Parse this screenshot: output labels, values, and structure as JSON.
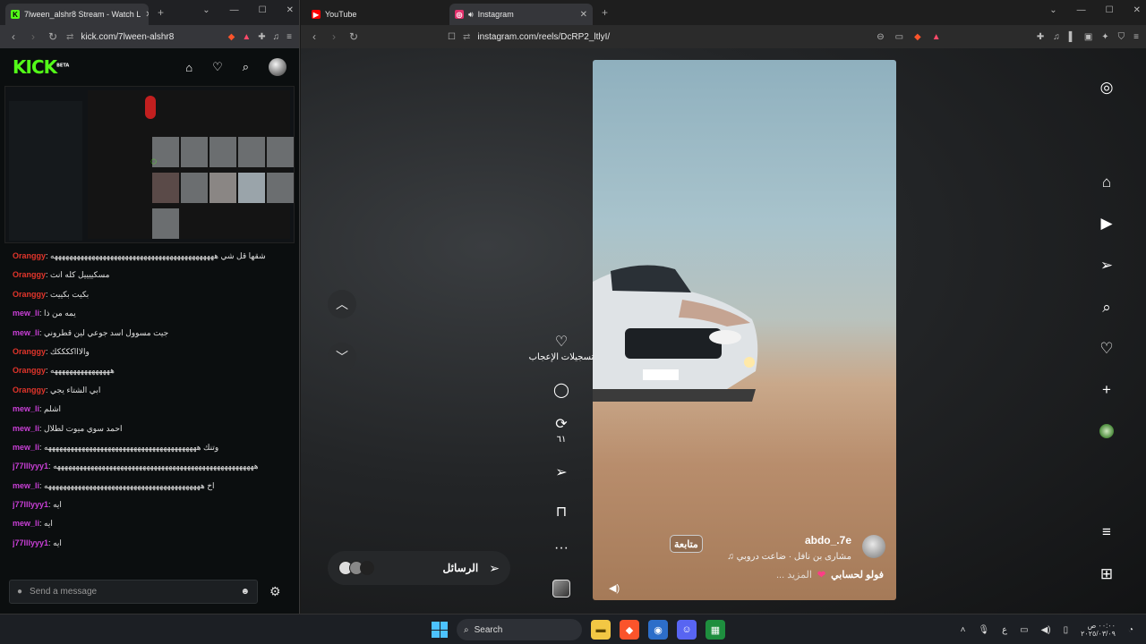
{
  "left_browser": {
    "tabs": [
      {
        "title": "7lween_alshr8 Stream - Watch L",
        "favicon": "kick-icon",
        "color": "#53fc18"
      }
    ],
    "url": "kick.com/7lween-alshr8",
    "kick": {
      "logo": "KICK",
      "beta": "BETA",
      "accent": "#53fc18"
    },
    "chat": {
      "messages": [
        {
          "user": "Oranggy",
          "color": "#e0352b",
          "text": "شقها قل شي ههههههههههههههههههههههههههههههههههههههههههههه"
        },
        {
          "user": "Oranggy",
          "color": "#e0352b",
          "text": "مسكييييل كله انت"
        },
        {
          "user": "Oranggy",
          "color": "#e0352b",
          "text": "بكيت بكييت"
        },
        {
          "user": "mew_li",
          "color": "#c93fd6",
          "text": "يمه من ذا"
        },
        {
          "user": "mew_li",
          "color": "#c93fd6",
          "text": "جيت مسوول اسد جوعي لين قطروني"
        },
        {
          "user": "Oranggy",
          "color": "#e0352b",
          "text": "والاااككككك"
        },
        {
          "user": "Oranggy",
          "color": "#e0352b",
          "text": "ههههههههههههههههه"
        },
        {
          "user": "Oranggy",
          "color": "#e0352b",
          "text": "ابي الشتاء يجي"
        },
        {
          "user": "mew_li",
          "color": "#c93fd6",
          "text": "اشلم"
        },
        {
          "user": "mew_li",
          "color": "#c93fd6",
          "text": "احمد سوي ميوت لطلال"
        },
        {
          "user": "mew_li",
          "color": "#c93fd6",
          "text": "وتنك هههههههههههههههههههههههههههههههههههههههههه"
        },
        {
          "user": "j77lllyyy1",
          "color": "#c93fd6",
          "text": "ههههههههههههههههههههههههههههههههههههههههههههههههههههههه"
        },
        {
          "user": "mew_li",
          "color": "#c93fd6",
          "text": "اخ ههههههههههههههههههههههههههههههههههههههههههه"
        },
        {
          "user": "j77lllyyy1",
          "color": "#c93fd6",
          "text": "ايه"
        },
        {
          "user": "mew_li",
          "color": "#c93fd6",
          "text": "ايه"
        },
        {
          "user": "j77lllyyy1",
          "color": "#c93fd6",
          "text": "ايه"
        }
      ],
      "placeholder": "Send a message"
    }
  },
  "right_browser": {
    "tabs": [
      {
        "title": "YouTube",
        "favicon": "youtube-icon",
        "color": "#ff0000"
      },
      {
        "title": "Instagram",
        "favicon": "instagram-icon",
        "color": "#e1306c"
      }
    ],
    "url": "instagram.com/reels/DcRP2_ltlyI/",
    "reel": {
      "username": "abdo_.7e",
      "follow_label": "متابعة",
      "music": "مشارى بن نافل · ضاعت دروبي",
      "caption": "فولو لحسابي",
      "more": "... المزيد",
      "likes_label": "تسجيلات الإعجاب",
      "reposts_count": "٦١"
    },
    "messages_bar": {
      "label": "الرسائل"
    }
  },
  "taskbar": {
    "search_label": "Search",
    "lang": "ع",
    "time": "٠٠:٠٠ ص",
    "date": "٢٠٢٥/٠٣/٠٩"
  }
}
